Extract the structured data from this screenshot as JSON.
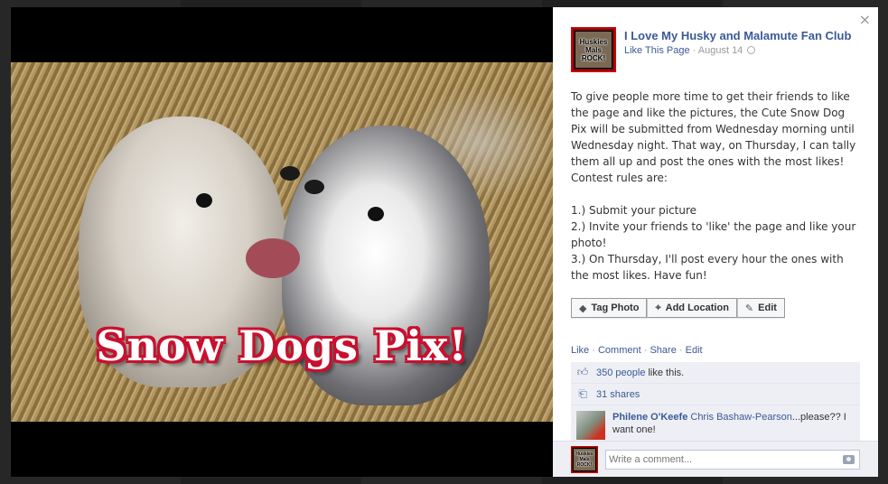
{
  "photo": {
    "overlay_text": "Snow Dogs Pix!"
  },
  "close_glyph": "×",
  "page": {
    "name": "I Love My Husky and Malamute Fan Club",
    "avatar_text": "Huskies Mals ROCK!",
    "like_link": "Like This Page",
    "separator": "·",
    "date": "August 14"
  },
  "post": {
    "paragraph1": "To give people more time to get their friends to like the page and like the pictures, the Cute Snow Dog Pix will be submitted from Wednesday morning until Wednesday night. That way, on Thursday, I can tally them all up and post the ones with the most likes! Contest rules are:",
    "rule1": "1.) Submit your picture",
    "rule2": "2.) Invite your friends to 'like' the page and like your photo!",
    "rule3": "3.) On Thursday, I'll post every hour the ones with the most likes. Have fun!"
  },
  "buttons": {
    "tag_photo": "Tag Photo",
    "add_location": "Add Location",
    "edit": "Edit"
  },
  "ufi": {
    "like": "Like",
    "comment": "Comment",
    "share": "Share",
    "edit": "Edit",
    "likes_count": "350 people",
    "likes_suffix": "like this.",
    "shares": "31 shares"
  },
  "comment": {
    "author": "Philene O'Keefe",
    "tagged": "Chris Bashaw-Pearson",
    "text": "...please?? I want one!"
  },
  "composer": {
    "placeholder": "Write a comment..."
  },
  "icons": {
    "tag": "tag-icon",
    "location": "location-pin-icon",
    "edit": "pencil-icon",
    "thumbs": "thumbs-up-icon",
    "share": "share-icon",
    "camera": "camera-icon",
    "clock": "clock-icon"
  },
  "colors": {
    "link": "#3b5998",
    "overlay_stroke": "#c8102e",
    "ufi_bg": "#edeff4"
  }
}
